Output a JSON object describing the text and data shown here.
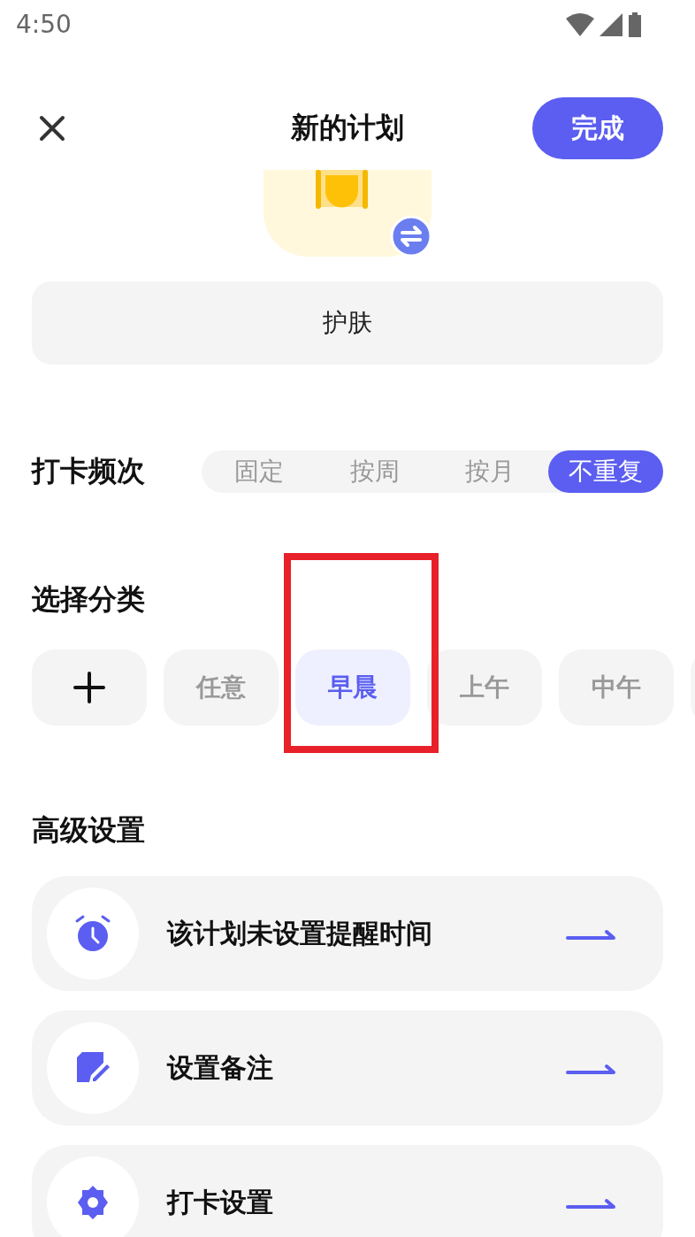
{
  "status_bar": {
    "time": "4:50"
  },
  "header": {
    "title": "新的计划",
    "done_button": "完成"
  },
  "name_field": {
    "value": "护肤"
  },
  "frequency": {
    "label": "打卡频次",
    "options": [
      {
        "label": "固定",
        "selected": false
      },
      {
        "label": "按周",
        "selected": false
      },
      {
        "label": "按月",
        "selected": false
      },
      {
        "label": "不重复",
        "selected": true
      }
    ]
  },
  "category": {
    "title": "选择分类",
    "chips": [
      {
        "label": "任意",
        "selected": false
      },
      {
        "label": "早晨",
        "selected": true
      },
      {
        "label": "上午",
        "selected": false
      },
      {
        "label": "中午",
        "selected": false
      }
    ]
  },
  "advanced": {
    "title": "高级设置",
    "items": [
      {
        "kind": "alarm",
        "label": "该计划未设置提醒时间"
      },
      {
        "kind": "note",
        "label": "设置备注"
      },
      {
        "kind": "gear",
        "label": "打卡设置"
      }
    ]
  }
}
